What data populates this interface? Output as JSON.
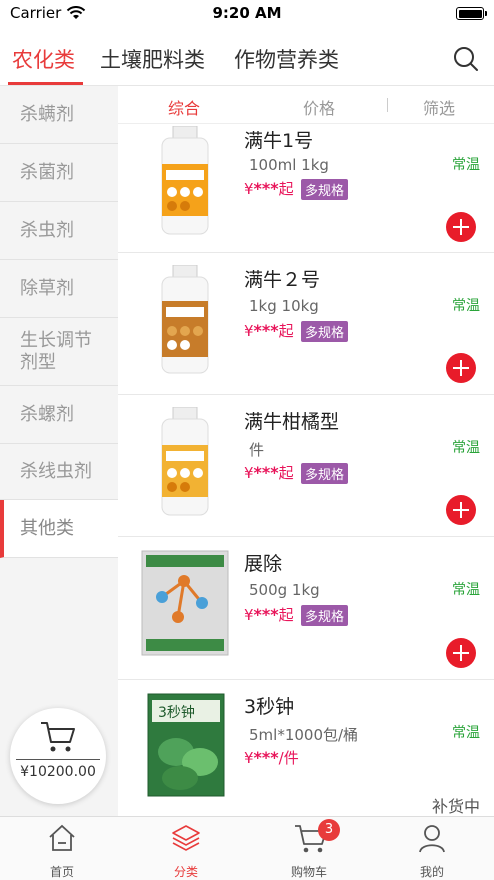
{
  "status_bar": {
    "carrier": "Carrier",
    "time": "9:20 AM"
  },
  "top_tabs": [
    {
      "label": "农化类",
      "active": true
    },
    {
      "label": "土壤肥料类",
      "active": false
    },
    {
      "label": "作物营养类",
      "active": false
    }
  ],
  "search": {
    "icon": "search-icon"
  },
  "sidebar": {
    "items": [
      {
        "label": "杀螨剂",
        "active": false
      },
      {
        "label": "杀菌剂",
        "active": false
      },
      {
        "label": "杀虫剂",
        "active": false
      },
      {
        "label": "除草剂",
        "active": false
      },
      {
        "label": "生长调节剂型",
        "active": false
      },
      {
        "label": "杀螺剂",
        "active": false
      },
      {
        "label": "杀线虫剂",
        "active": false
      },
      {
        "label": "其他类",
        "active": true
      }
    ]
  },
  "cart_float": {
    "amount": "¥10200.00",
    "icon": "cart-icon"
  },
  "sort_bar": {
    "items": [
      {
        "label": "综合",
        "active": true
      },
      {
        "label": "价格",
        "active": false
      },
      {
        "label": "筛选",
        "active": false
      }
    ]
  },
  "products": [
    {
      "name": "满牛1号",
      "spec": "100ml  1kg",
      "price_symbol": "¥",
      "price": "***",
      "price_suffix": "起",
      "badge": "多规格",
      "temp": "常温",
      "image": "white-orange-bottle",
      "add_icon": "plus-icon"
    },
    {
      "name": "满牛２号",
      "spec": "1kg  10kg",
      "price_symbol": "¥",
      "price": "***",
      "price_suffix": "起",
      "badge": "多规格",
      "temp": "常温",
      "image": "white-orange-bottle",
      "add_icon": "plus-icon"
    },
    {
      "name": "满牛柑橘型",
      "spec": "件",
      "price_symbol": "¥",
      "price": "***",
      "price_suffix": "起",
      "badge": "多规格",
      "temp": "常温",
      "image": "white-orange-bottle",
      "add_icon": "plus-icon"
    },
    {
      "name": "展除",
      "spec": "500g  1kg",
      "price_symbol": "¥",
      "price": "***",
      "price_suffix": "起",
      "badge": "多规格",
      "temp": "常温",
      "image": "grey-bag",
      "add_icon": "plus-icon"
    },
    {
      "name": "3秒钟",
      "spec": "5ml*1000包/桶",
      "price_symbol": "¥",
      "price": "***",
      "price_suffix": "/件",
      "temp": "常温",
      "status": "补货中",
      "image": "green-package"
    }
  ],
  "tabbar": {
    "items": [
      {
        "label": "首页",
        "icon": "home-icon",
        "active": false
      },
      {
        "label": "分类",
        "icon": "layers-icon",
        "active": true
      },
      {
        "label": "购物车",
        "icon": "cart-icon",
        "active": false,
        "count": "3"
      },
      {
        "label": "我的",
        "icon": "user-icon",
        "active": false
      }
    ]
  },
  "colors": {
    "accent": "#e83b3b",
    "price": "#e8155a",
    "badge": "#9c59a8",
    "temp": "#2aa43a",
    "add": "#e81c2a"
  }
}
